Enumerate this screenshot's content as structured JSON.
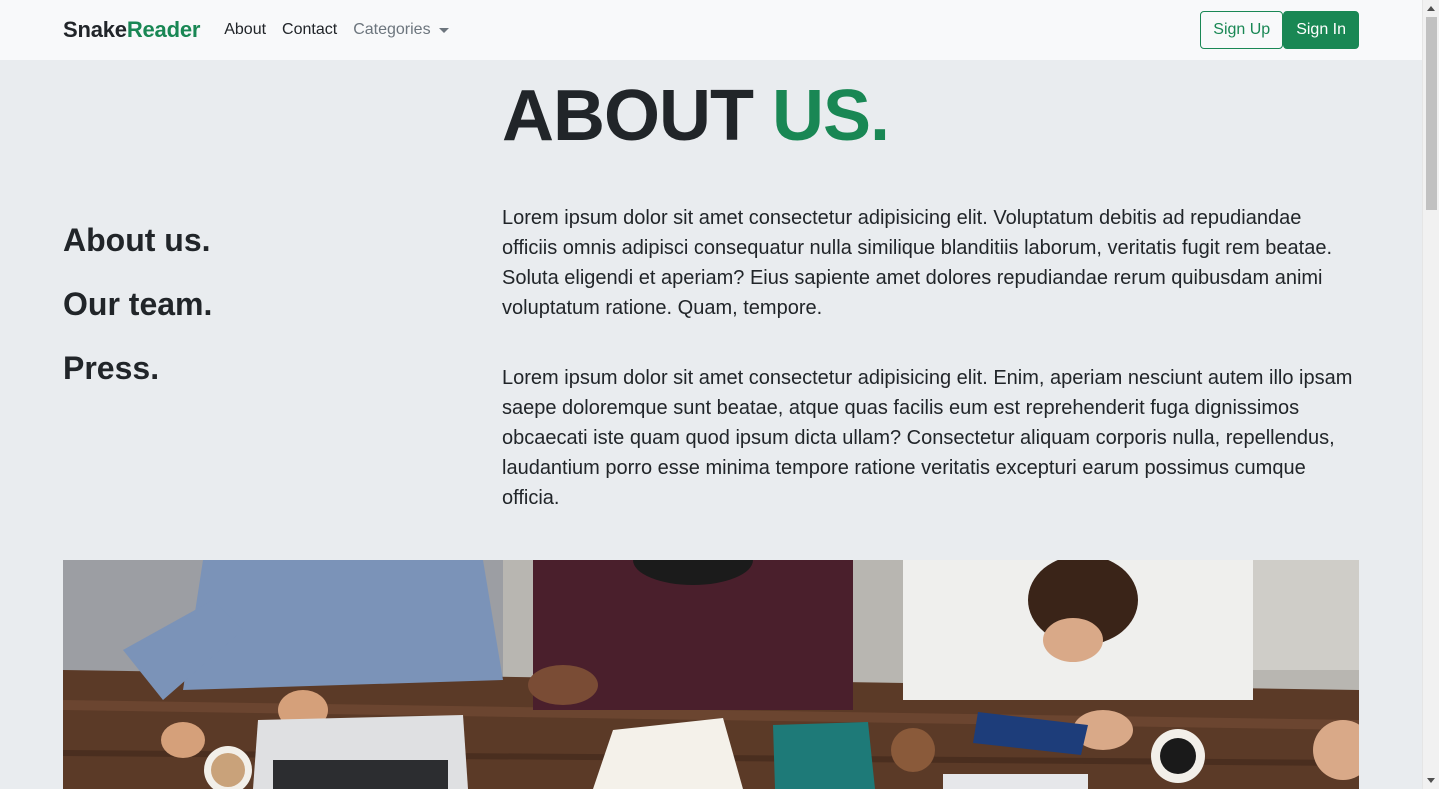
{
  "navbar": {
    "brand_part1": "Snake",
    "brand_part2": "Reader",
    "links": [
      "About",
      "Contact"
    ],
    "dropdown_label": "Categories",
    "signup_label": "Sign Up",
    "signin_label": "Sign In"
  },
  "hero": {
    "title_part1": "ABOUT ",
    "title_part2": "US."
  },
  "side_menu": [
    "About us.",
    "Our team.",
    "Press."
  ],
  "paragraphs": [
    "Lorem ipsum dolor sit amet consectetur adipisicing elit. Voluptatum debitis ad repudiandae officiis omnis adipisci consequatur nulla similique blanditiis laborum, veritatis fugit rem beatae. Soluta eligendi et aperiam? Eius sapiente amet dolores repudiandae rerum quibusdam animi voluptatum ratione. Quam, tempore.",
    "Lorem ipsum dolor sit amet consectetur adipisicing elit. Enim, aperiam nesciunt autem illo ipsam saepe doloremque sunt beatae, atque quas facilis eum est reprehenderit fuga dignissimos obcaecati iste quam quod ipsum dicta ullam? Consectetur aliquam corporis nulla, repellendus, laudantium porro esse minima tempore ratione veritatis excepturi earum possimus cumque officia."
  ],
  "colors": {
    "accent": "#198754",
    "background": "#e9ecef",
    "navbar_bg": "#f8f9fa",
    "text": "#212529"
  },
  "image": {
    "icon": "team-photo"
  }
}
